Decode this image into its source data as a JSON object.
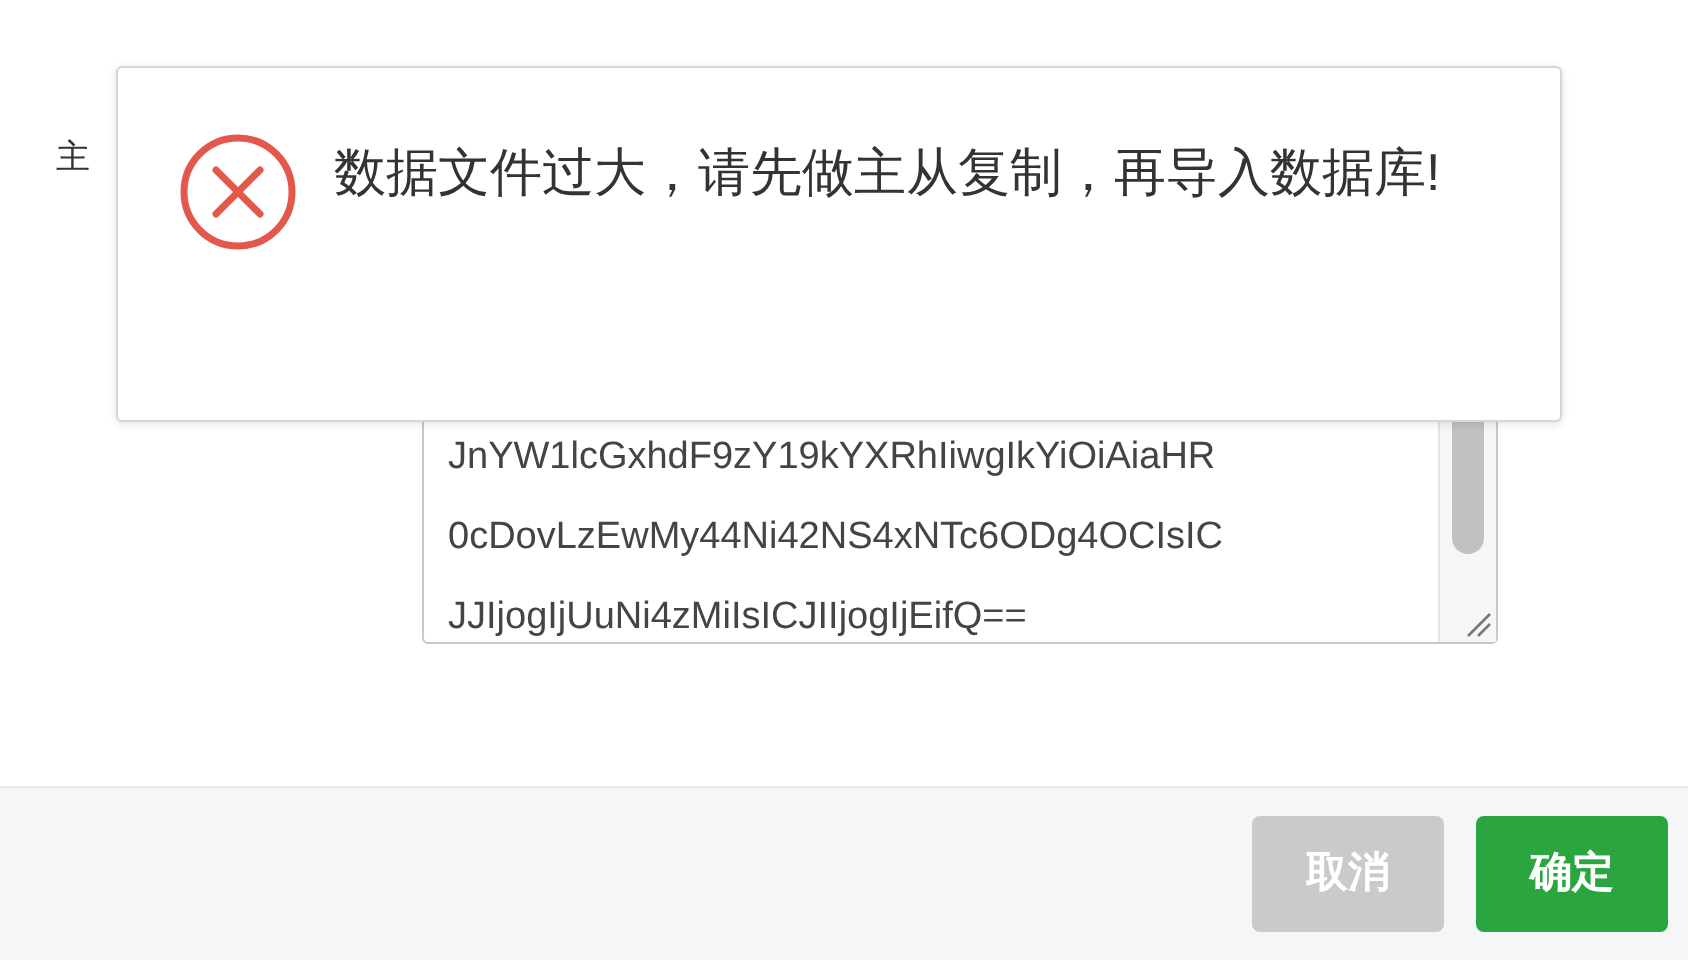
{
  "form": {
    "label": "主",
    "textarea_lines": [
      "JnYW1lcGxhdF9zY19kYXRhIiwgIkYiOiAiaHR",
      "0cDovLzEwMy44Ni42NS4xNTc6ODg4OCIsIC",
      "JJIjogIjUuNi4zMiIsICJIIjogIjEifQ=="
    ]
  },
  "toast": {
    "kind": "error",
    "message": "数据文件过大，请先做主从复制，再导入数据库!"
  },
  "buttons": [
    {
      "label": "取消",
      "disabled": true
    },
    {
      "label": "确定",
      "disabled": false
    }
  ]
}
